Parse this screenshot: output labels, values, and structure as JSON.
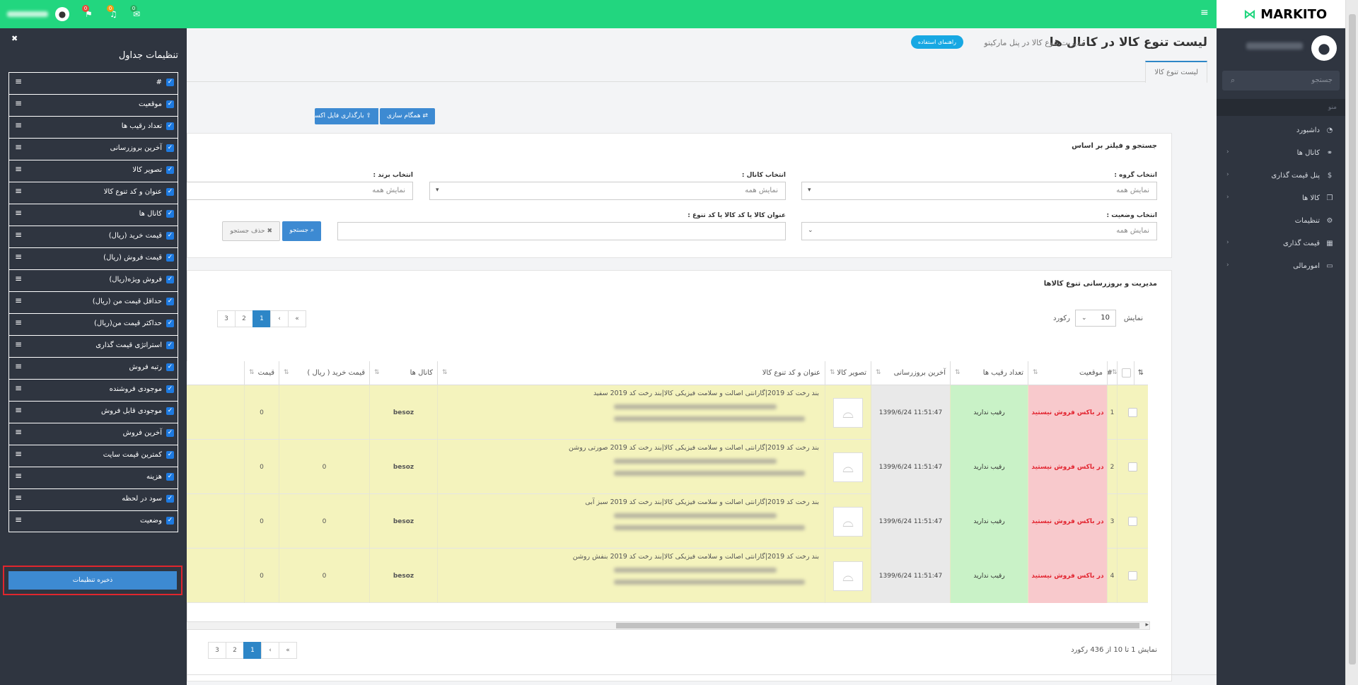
{
  "brand": {
    "name": "MARKITO"
  },
  "sidebar": {
    "search_placeholder": "جستجو",
    "section_label": "منو",
    "items": [
      {
        "label": "داشبورد",
        "icon": "dashboard-icon",
        "glyph": "◔",
        "has_children": false
      },
      {
        "label": "کانال ها",
        "icon": "link-icon",
        "glyph": "⚭",
        "has_children": true
      },
      {
        "label": "پنل قیمت گذاری",
        "icon": "dollar-icon",
        "glyph": "$",
        "has_children": true
      },
      {
        "label": "کالا ها",
        "icon": "cubes-icon",
        "glyph": "❒",
        "has_children": true
      },
      {
        "label": "تنظیمات",
        "icon": "gear-icon",
        "glyph": "⚙",
        "has_children": false
      },
      {
        "label": "قیمت گذاری",
        "icon": "chart-icon",
        "glyph": "▦",
        "has_children": true
      },
      {
        "label": "امورمالی",
        "icon": "card-icon",
        "glyph": "▭",
        "has_children": true
      }
    ]
  },
  "topbar": {
    "badges": [
      {
        "value": "0",
        "color": "#e74c3c"
      },
      {
        "value": "0",
        "color": "#f39c12"
      },
      {
        "value": "0",
        "color": "#27ae60"
      }
    ]
  },
  "page": {
    "title": "لیست تنوع کالا در کانال ها",
    "subtitle": "مدیریت تنوع کالا در پنل مارکیتو",
    "help_button": "راهنمای استفاده",
    "tab": "لیست تنوع کالا",
    "sync_button": "همگام سازی",
    "upload_button": "بارگذاری فایل اکسل"
  },
  "filters": {
    "title": "جستجو و فیلتر بر اساس",
    "group_label": "انتخاب گروه :",
    "group_value": "نمایش همه",
    "channel_label": "انتخاب کانال :",
    "channel_value": "نمایش همه",
    "brand_label": "انتخاب برند :",
    "brand_value": "نمایش همه",
    "status_label": "انتخاب وضعیت :",
    "status_value": "نمایش همه",
    "query_label": "عنوان کالا یا کد کالا یا کد تنوع :",
    "search_button": "جستجو",
    "clear_button": "حذف جستجو"
  },
  "table_panel": {
    "title": "مدیریت و بروزرسانی تنوع کالاها",
    "show_label": "نمایش",
    "page_size": "10",
    "records_label": "رکورد",
    "pages": [
      "1",
      "2",
      "3"
    ],
    "footer_info": "نمایش 1 تا 10 از 436 رکورد"
  },
  "columns": [
    "",
    "#",
    "موقعیت",
    "تعداد رقیب ها",
    "آخرین بروزرسانی",
    "تصویر کالا",
    "عنوان و کد تنوع کالا",
    "کانال ها",
    "قیمت خرید ( ریال )",
    "قیمت"
  ],
  "rows": [
    {
      "num": "1",
      "status": "در باکس فروش نیستید",
      "rival": "رقیب ندارید",
      "updated": "11:51:47 1399/6/24",
      "title": "بند رخت کد 2019|گارانتی اصالت و سلامت فیزیکی کالا|بند رخت کد 2019 سفید",
      "channel": "besoz",
      "buy_price": "",
      "price": "0"
    },
    {
      "num": "2",
      "status": "در باکس فروش نیستید",
      "rival": "رقیب ندارید",
      "updated": "11:51:47 1399/6/24",
      "title": "بند رخت کد 2019|گارانتی اصالت و سلامت فیزیکی کالا|بند رخت کد 2019 صورتی روشن",
      "channel": "besoz",
      "buy_price": "0",
      "price": "0"
    },
    {
      "num": "3",
      "status": "در باکس فروش نیستید",
      "rival": "رقیب ندارید",
      "updated": "11:51:47 1399/6/24",
      "title": "بند رخت کد 2019|گارانتی اصالت و سلامت فیزیکی کالا|بند رخت کد 2019 سبز آبی",
      "channel": "besoz",
      "buy_price": "0",
      "price": "0"
    },
    {
      "num": "4",
      "status": "در باکس فروش نیستید",
      "rival": "رقیب ندارید",
      "updated": "11:51:47 1399/6/24",
      "title": "بند رخت کد 2019|گارانتی اصالت و سلامت فیزیکی کالا|بند رخت کد 2019 بنفش روشن",
      "channel": "besoz",
      "buy_price": "0",
      "price": "0"
    }
  ],
  "table_settings": {
    "title": "تنظیمات جداول",
    "columns": [
      "#",
      "موقعیت",
      "تعداد رقیب ها",
      "آخرین بروزرسانی",
      "تصویر کالا",
      "عنوان و کد تنوع کالا",
      "کانال ها",
      "قیمت خرید (ریال)",
      "قیمت فروش (ریال)",
      "فروش ویژه(ریال)",
      "حداقل قیمت من (ریال)",
      "حداکثر قیمت من(ریال)",
      "استراتژی قیمت گذاری",
      "رتبه فروش",
      "موجودی فروشنده",
      "موجودی قابل فروش",
      "آخرین فروش",
      "کمترین قیمت سایت",
      "هزینه",
      "سود در لحظه",
      "وضعیت"
    ],
    "save_button": "ذخیره تنظیمات"
  }
}
